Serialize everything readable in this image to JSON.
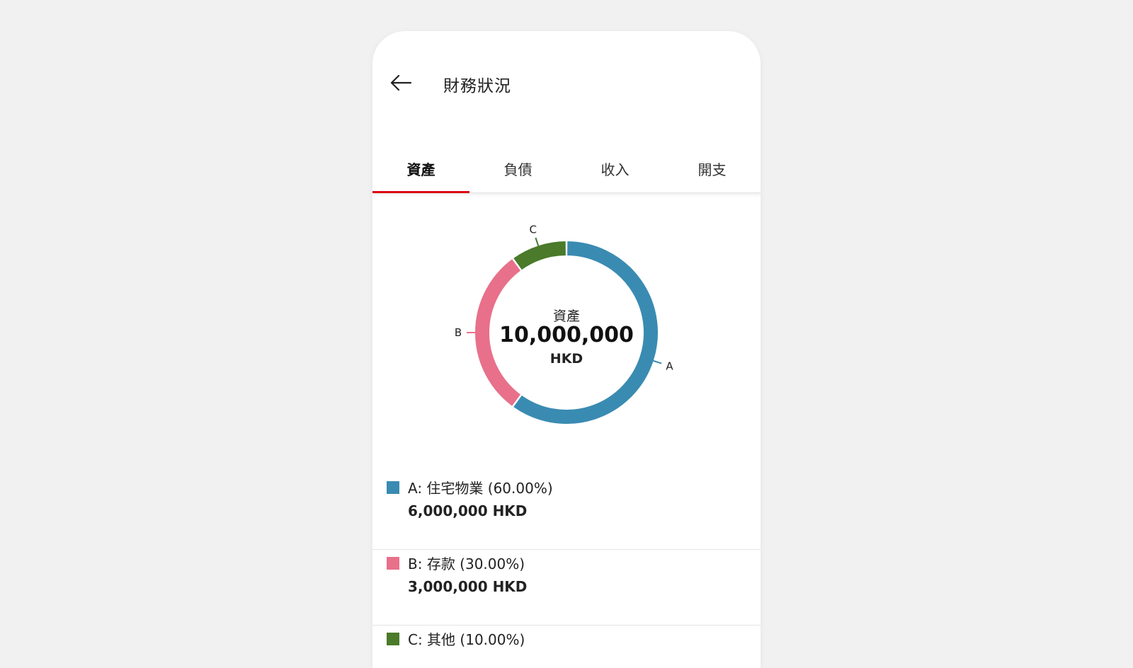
{
  "header": {
    "title": "財務狀況"
  },
  "tabs": [
    {
      "label": "資產",
      "active": true
    },
    {
      "label": "負債",
      "active": false
    },
    {
      "label": "收入",
      "active": false
    },
    {
      "label": "開支",
      "active": false
    }
  ],
  "colors": {
    "accent": "#db0011",
    "series_a": "#3a8bb2",
    "series_b": "#e8708a",
    "series_c": "#4a7a2a"
  },
  "chart_center": {
    "label": "資產",
    "value": "10,000,000",
    "currency": "HKD"
  },
  "chart_data": {
    "type": "pie",
    "categories": [
      "A",
      "B",
      "C"
    ],
    "values": [
      60,
      30,
      10
    ],
    "colors": [
      "#3a8bb2",
      "#e8708a",
      "#4a7a2a"
    ]
  },
  "legend": [
    {
      "label": "A: 住宅物業 (60.00%)",
      "amount": "6,000,000 HKD"
    },
    {
      "label": "B: 存款 (30.00%)",
      "amount": "3,000,000 HKD"
    },
    {
      "label": "C: 其他 (10.00%)",
      "amount": ""
    }
  ]
}
